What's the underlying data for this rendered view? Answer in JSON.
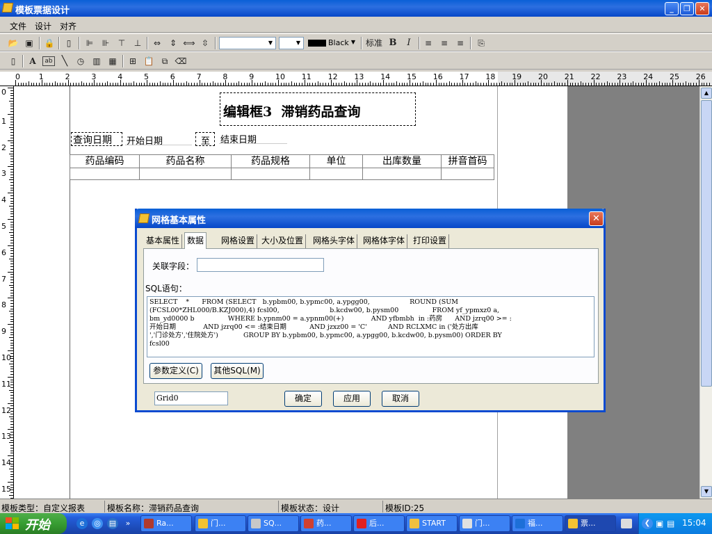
{
  "window": {
    "title": "模板票据设计",
    "min": "_",
    "max": "❐",
    "close": "✕"
  },
  "menu": [
    "文件",
    "设计",
    "对齐"
  ],
  "toolbar": {
    "font_combo": "",
    "size_combo": "",
    "color_name": "Black",
    "style_label": "标准",
    "bold": "B",
    "italic": "I"
  },
  "ruler": {
    "h": [
      "0",
      "1",
      "2",
      "3",
      "4",
      "5",
      "6",
      "7",
      "8",
      "9",
      "10",
      "11",
      "12",
      "13",
      "14",
      "15",
      "16",
      "17",
      "18",
      "19",
      "20",
      "21",
      "22",
      "23",
      "24",
      "25",
      "26"
    ],
    "v": [
      "0",
      "1",
      "2",
      "3",
      "4",
      "5",
      "6",
      "7",
      "8",
      "9",
      "10",
      "11",
      "12",
      "13",
      "14",
      "15"
    ]
  },
  "design": {
    "title_box": "编辑框3  滞销药品查询",
    "query_date_label": "查询日期",
    "start_date": "开始日期",
    "to_label": "至",
    "end_date": "结束日期",
    "grid_headers": [
      "药品编码",
      "药品名称",
      "药品规格",
      "单位",
      "出库数量",
      "拼音首码"
    ]
  },
  "dialog": {
    "title": "网格基本属性",
    "close": "✕",
    "tabs": [
      "基本属性",
      "数据",
      "网格设置",
      "大小及位置",
      "网格头字体",
      "网格体字体",
      "打印设置"
    ],
    "active_tab": "数据",
    "field_label": "关联字段：",
    "field_value": "",
    "sql_label": "SQL语句：",
    "sql_text": "SELECT    *      FROM (SELECT   b.ypbm00, b.ypmc00, a.ypgg00,                   ROUND (SUM\n(FCSL00*ZHL000/B.KZJ000),4) fcsl00,                        b.kcdw00, b.pysm00                FROM yf_ypmxz0 a,\nbm_yd0000 b                WHERE b.ypnm00 = a.ypnm00(+)             AND yfbmbh  in :药房      AND jzrq00 >= :\n开始日期             AND jzrq00 <= :结束日期           AND jzxz00 = 'C'          AND RCLXMC in ('处方出库\n','门诊处方','住院处方')            GROUP BY b.ypbm00, b.ypmc00, a.ypgg00, b.kcdw00, b.pysm00) ORDER BY\nfcsl00",
    "param_button": "参数定义(C)",
    "other_sql_button": "其他SQL(M)",
    "grid_name": "Grid0",
    "ok": "确定",
    "apply": "应用",
    "cancel": "取消"
  },
  "status": {
    "type": "模板类型：自定义报表",
    "name": "模板名称：滞销药品查询",
    "state": "模板状态：设计",
    "id": "模板ID:25"
  },
  "taskbar": {
    "start": "开始",
    "more": "»",
    "tasks": [
      "Ra...",
      "门...",
      "SQ...",
      "药...",
      "后...",
      "START",
      "门...",
      "福...",
      "票..."
    ],
    "clock": "15:04"
  }
}
